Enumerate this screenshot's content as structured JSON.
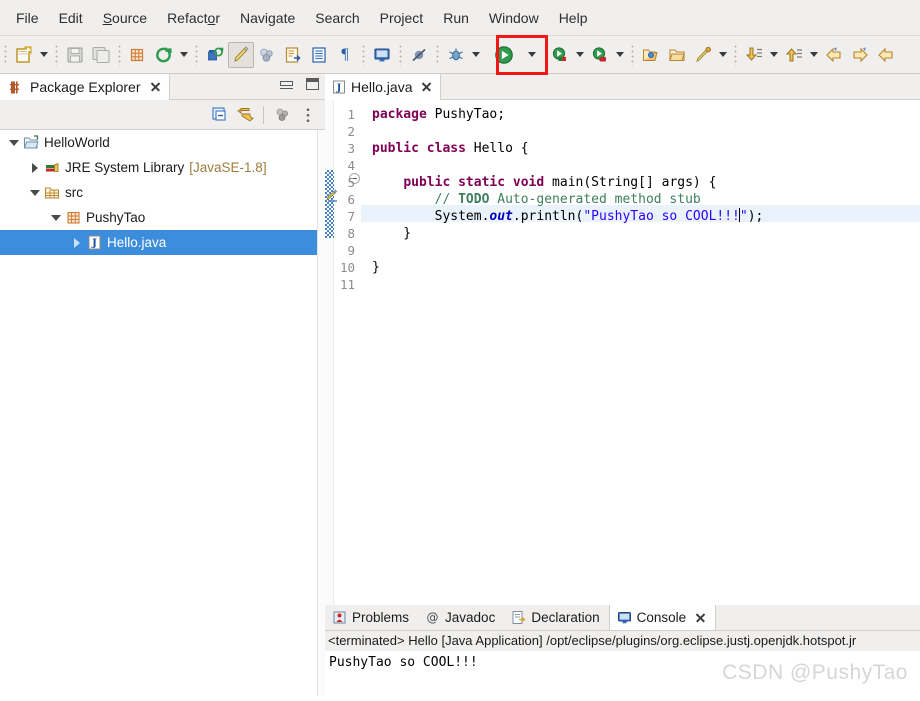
{
  "menubar": {
    "items": [
      {
        "label": "File",
        "mnemonic_index": -1
      },
      {
        "label": "Edit",
        "mnemonic_index": -1
      },
      {
        "label": "Source",
        "mnemonic_index": 0
      },
      {
        "label": "Refactor",
        "mnemonic_index": 6
      },
      {
        "label": "Navigate",
        "mnemonic_index": -1
      },
      {
        "label": "Search",
        "mnemonic_index": -1
      },
      {
        "label": "Project",
        "mnemonic_index": -1
      },
      {
        "label": "Run",
        "mnemonic_index": -1
      },
      {
        "label": "Window",
        "mnemonic_index": -1
      },
      {
        "label": "Help",
        "mnemonic_index": -1
      }
    ]
  },
  "toolbar": {
    "highlight_color": "#f11717",
    "buttons": [
      {
        "name": "new-wizard-icon",
        "tooltip": "New"
      },
      {
        "name": "new-wizard-dropdown-icon",
        "tooltip": "New menu"
      },
      {
        "name": "save-icon",
        "tooltip": "Save"
      },
      {
        "name": "save-all-icon",
        "tooltip": "Save All"
      },
      {
        "name": "new-java-package-icon",
        "tooltip": "New Java Package"
      },
      {
        "name": "new-java-class-icon",
        "tooltip": "New Java Class"
      },
      {
        "name": "new-java-class-dropdown-icon",
        "tooltip": "New Java Class menu"
      },
      {
        "name": "open-type-icon",
        "tooltip": "Open Type"
      },
      {
        "name": "toggle-mark-occurrences-icon",
        "tooltip": "Toggle Mark Occurrences"
      },
      {
        "name": "build-all-icon",
        "tooltip": "Build"
      },
      {
        "name": "new-java-project-icon",
        "tooltip": "New Java Project"
      },
      {
        "name": "open-task-icon",
        "tooltip": "Open Task"
      },
      {
        "name": "pilcrow-icon",
        "tooltip": "Show Whitespace"
      },
      {
        "name": "remote-java-icon",
        "tooltip": "Remote Java Application"
      },
      {
        "name": "skip-breakpoints-icon",
        "tooltip": "Skip All Breakpoints"
      },
      {
        "name": "debug-icon",
        "tooltip": "Debug"
      },
      {
        "name": "debug-dropdown-icon",
        "tooltip": "Debug menu"
      },
      {
        "name": "run-icon",
        "tooltip": "Run"
      },
      {
        "name": "run-dropdown-icon",
        "tooltip": "Run menu"
      },
      {
        "name": "run-external-tools-icon",
        "tooltip": "External Tools"
      },
      {
        "name": "run-external-tools-dropdown-icon",
        "tooltip": "External Tools menu"
      },
      {
        "name": "coverage-icon",
        "tooltip": "Coverage"
      },
      {
        "name": "coverage-dropdown-icon",
        "tooltip": "Coverage menu"
      },
      {
        "name": "open-perspective-icon",
        "tooltip": "Open Perspective"
      },
      {
        "name": "open-folder-icon",
        "tooltip": "Open Folder"
      },
      {
        "name": "search-marker-icon",
        "tooltip": "Search"
      },
      {
        "name": "search-marker-dropdown-icon",
        "tooltip": "Search menu"
      },
      {
        "name": "next-annotation-icon",
        "tooltip": "Next Annotation"
      },
      {
        "name": "next-annotation-dropdown-icon",
        "tooltip": "Next Annotation menu"
      },
      {
        "name": "previous-annotation-icon",
        "tooltip": "Previous Annotation"
      },
      {
        "name": "previous-annotation-dropdown-icon",
        "tooltip": "Previous Annotation menu"
      },
      {
        "name": "back-icon",
        "tooltip": "Back"
      },
      {
        "name": "forward-icon",
        "tooltip": "Forward"
      },
      {
        "name": "last-edit-icon",
        "tooltip": "Last Edit Location"
      }
    ]
  },
  "package_explorer": {
    "tab_title": "Package Explorer",
    "toolbar": [
      {
        "name": "collapse-all-icon",
        "tooltip": "Collapse All"
      },
      {
        "name": "link-with-editor-icon",
        "tooltip": "Link with Editor"
      },
      {
        "name": "view-menu-icon",
        "tooltip": "View Menu"
      },
      {
        "name": "view-overflow-icon",
        "tooltip": "View Overflow"
      }
    ],
    "tree": [
      {
        "label": "HelloWorld",
        "sub": "",
        "depth": 0,
        "expanded": true,
        "icon": "project-icon",
        "selected": false
      },
      {
        "label": "JRE System Library",
        "sub": "[JavaSE-1.8]",
        "depth": 1,
        "expanded": false,
        "icon": "library-icon",
        "selected": false
      },
      {
        "label": "src",
        "sub": "",
        "depth": 1,
        "expanded": true,
        "icon": "source-folder-icon",
        "selected": false
      },
      {
        "label": "PushyTao",
        "sub": "",
        "depth": 2,
        "expanded": true,
        "icon": "package-icon",
        "selected": false
      },
      {
        "label": "Hello.java",
        "sub": "",
        "depth": 3,
        "expanded": false,
        "icon": "java-file-icon",
        "selected": true
      }
    ]
  },
  "editor": {
    "tab_title": "Hello.java",
    "tab_icon": "java-file-icon",
    "current_line": 7,
    "lines": [
      {
        "number": "1",
        "text": "package PushyTao;"
      },
      {
        "number": "2",
        "text": ""
      },
      {
        "number": "3",
        "text": "public class Hello {"
      },
      {
        "number": "4",
        "text": ""
      },
      {
        "number": "5",
        "text": "    public static void main(String[] args) {"
      },
      {
        "number": "6",
        "text": "        // TODO Auto-generated method stub"
      },
      {
        "number": "7",
        "text": "        System.out.println(\"PushyTao so COOL!!!\");"
      },
      {
        "number": "8",
        "text": "    }"
      },
      {
        "number": "9",
        "text": ""
      },
      {
        "number": "10",
        "text": "}"
      },
      {
        "number": "11",
        "text": ""
      }
    ]
  },
  "bottom": {
    "tabs": [
      {
        "label": "Problems",
        "icon": "problems-icon",
        "active": false,
        "closable": false
      },
      {
        "label": "Javadoc",
        "icon": "javadoc-icon",
        "active": false,
        "closable": false
      },
      {
        "label": "Declaration",
        "icon": "declaration-icon",
        "active": false,
        "closable": false
      },
      {
        "label": "Console",
        "icon": "console-icon",
        "active": true,
        "closable": true
      }
    ],
    "console_header": "<terminated> Hello [Java Application] /opt/eclipse/plugins/org.eclipse.justj.openjdk.hotspot.jr",
    "console_output": "PushyTao so COOL!!!"
  },
  "watermark": "CSDN @PushyTao"
}
